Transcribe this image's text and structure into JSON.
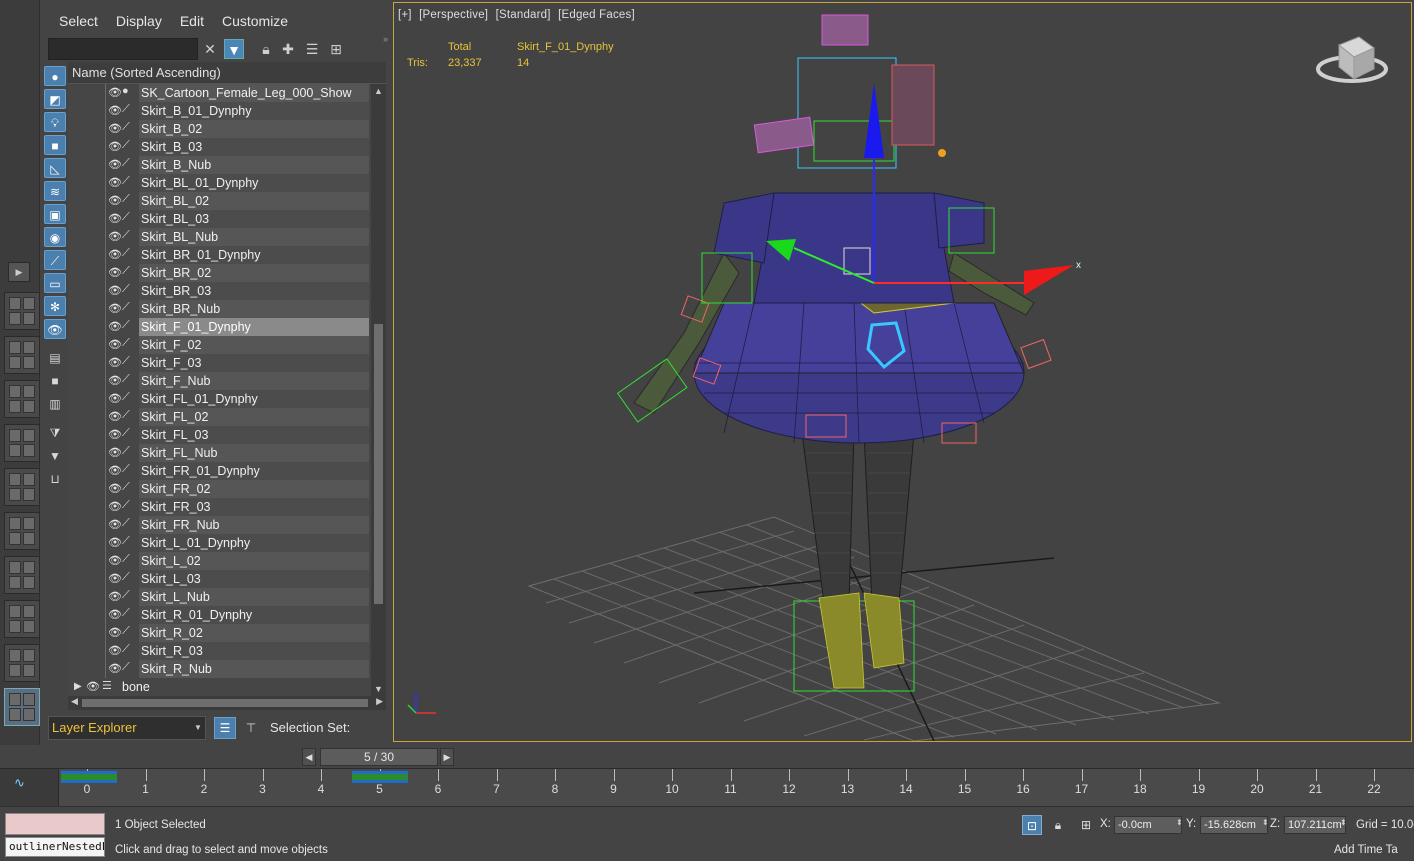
{
  "menu": [
    "Select",
    "Display",
    "Edit",
    "Customize"
  ],
  "explorer": {
    "column_header": "Name (Sorted Ascending)",
    "items": [
      {
        "name": "SK_Cartoon_Female_Leg_000_Show",
        "kind": "mesh"
      },
      {
        "name": "Skirt_B_01_Dynphy",
        "kind": "bone"
      },
      {
        "name": "Skirt_B_02",
        "kind": "bone"
      },
      {
        "name": "Skirt_B_03",
        "kind": "bone"
      },
      {
        "name": "Skirt_B_Nub",
        "kind": "bone"
      },
      {
        "name": "Skirt_BL_01_Dynphy",
        "kind": "bone"
      },
      {
        "name": "Skirt_BL_02",
        "kind": "bone"
      },
      {
        "name": "Skirt_BL_03",
        "kind": "bone"
      },
      {
        "name": "Skirt_BL_Nub",
        "kind": "bone"
      },
      {
        "name": "Skirt_BR_01_Dynphy",
        "kind": "bone"
      },
      {
        "name": "Skirt_BR_02",
        "kind": "bone"
      },
      {
        "name": "Skirt_BR_03",
        "kind": "bone"
      },
      {
        "name": "Skirt_BR_Nub",
        "kind": "bone"
      },
      {
        "name": "Skirt_F_01_Dynphy",
        "kind": "bone",
        "selected": true
      },
      {
        "name": "Skirt_F_02",
        "kind": "bone"
      },
      {
        "name": "Skirt_F_03",
        "kind": "bone"
      },
      {
        "name": "Skirt_F_Nub",
        "kind": "bone"
      },
      {
        "name": "Skirt_FL_01_Dynphy",
        "kind": "bone"
      },
      {
        "name": "Skirt_FL_02",
        "kind": "bone"
      },
      {
        "name": "Skirt_FL_03",
        "kind": "bone"
      },
      {
        "name": "Skirt_FL_Nub",
        "kind": "bone"
      },
      {
        "name": "Skirt_FR_01_Dynphy",
        "kind": "bone"
      },
      {
        "name": "Skirt_FR_02",
        "kind": "bone"
      },
      {
        "name": "Skirt_FR_03",
        "kind": "bone"
      },
      {
        "name": "Skirt_FR_Nub",
        "kind": "bone"
      },
      {
        "name": "Skirt_L_01_Dynphy",
        "kind": "bone"
      },
      {
        "name": "Skirt_L_02",
        "kind": "bone"
      },
      {
        "name": "Skirt_L_03",
        "kind": "bone"
      },
      {
        "name": "Skirt_L_Nub",
        "kind": "bone"
      },
      {
        "name": "Skirt_R_01_Dynphy",
        "kind": "bone"
      },
      {
        "name": "Skirt_R_02",
        "kind": "bone"
      },
      {
        "name": "Skirt_R_03",
        "kind": "bone"
      },
      {
        "name": "Skirt_R_Nub",
        "kind": "bone"
      }
    ],
    "layer": {
      "name": "bone"
    },
    "bottom": {
      "layer_explorer": "Layer Explorer",
      "selection_set": "Selection Set:"
    }
  },
  "viewport": {
    "labels": [
      "[+]",
      "[Perspective]",
      "[Standard]",
      "[Edged Faces]"
    ],
    "stats": {
      "total_label": "Total",
      "selected_name": "Skirt_F_01_Dynphy",
      "tris_label": "Tris:",
      "tris_total": "23,337",
      "tris_selected": "14"
    },
    "axis_labels": [
      "x",
      "y",
      "z"
    ]
  },
  "timeline": {
    "frame_display": "5 / 30",
    "current_frame": 5,
    "tick_labels": [
      "0",
      "1",
      "2",
      "3",
      "4",
      "5",
      "6",
      "7",
      "8",
      "9",
      "10",
      "11",
      "12",
      "13",
      "14",
      "15",
      "16",
      "17",
      "18",
      "19",
      "20",
      "21",
      "22"
    ]
  },
  "status": {
    "selection": "1 Object Selected",
    "prompt": "Click and drag to select and move objects",
    "script_text": "outlinerNestedL",
    "x_label": "X:",
    "x_value": "-0.0cm",
    "y_label": "Y:",
    "y_value": "-15.628cm",
    "z_label": "Z:",
    "z_value": "107.211cm",
    "grid": "Grid = 10.0c",
    "add_time": "Add Time Ta"
  },
  "colors": {
    "selection_accent": "#4b7fae",
    "viewport_border": "#c8a43a",
    "stats_text": "#e6c53a",
    "layer_explorer_text": "#f0c23c"
  }
}
